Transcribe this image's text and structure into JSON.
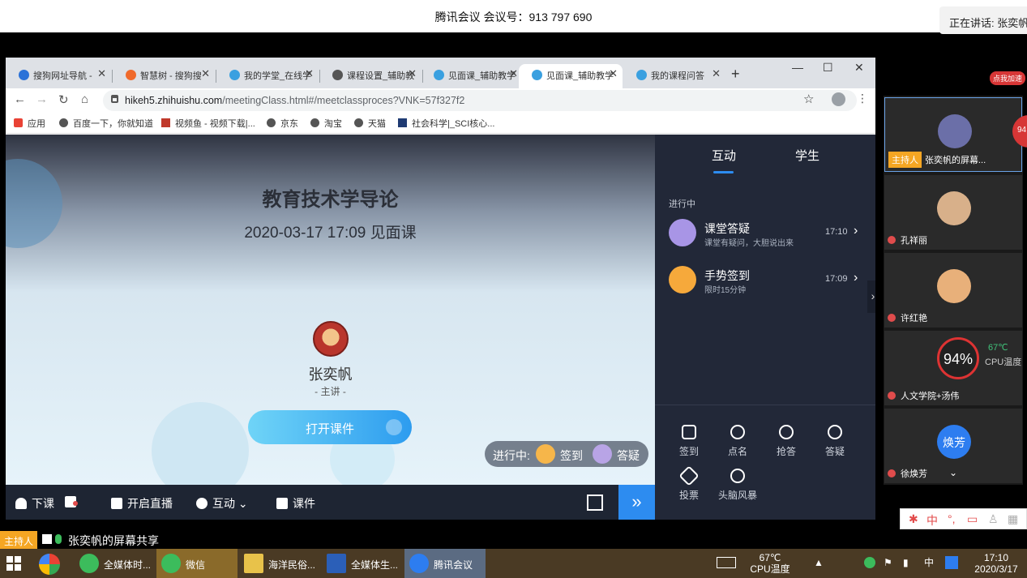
{
  "meeting": {
    "title": "腾讯会议 会议号：913 797 690",
    "speaking": "正在讲话: 张奕帆;"
  },
  "browser": {
    "tabs": [
      {
        "label": "搜狗网址导航 -",
        "color": "#2b72d8"
      },
      {
        "label": "智慧树 - 搜狗搜",
        "color": "#f06a2c"
      },
      {
        "label": "我的学堂_在线学",
        "color": "#3aa0e0"
      },
      {
        "label": "课程设置_辅助教",
        "color": "#555555"
      },
      {
        "label": "见面课_辅助教学",
        "color": "#3aa0e0"
      },
      {
        "label": "见面课_辅助教学",
        "color": "#3aa0e0"
      },
      {
        "label": "我的课程问答",
        "color": "#3aa0e0"
      }
    ],
    "new_tab": "+",
    "window_controls": {
      "minimize": "—",
      "maximize": "☐",
      "close": "✕"
    },
    "url_domain": "hikeh5.zhihuishu.com",
    "url_path": "/meetingClass.html#/meetclassproces?VNK=57f327f2",
    "bookmarks": [
      "应用",
      "百度一下，你就知道",
      "视频鱼 - 视频下载|...",
      "京东",
      "淘宝",
      "天猫",
      "社会科学|_SCI核心..."
    ]
  },
  "stage": {
    "course_title": "教育技术学导论",
    "course_time": "2020-03-17 17:09 见面课",
    "host_name": "张奕帆",
    "host_role": "- 主讲 -",
    "open_button": "打开课件",
    "in_progress": {
      "label": "进行中:",
      "item1": "签到",
      "item2": "答疑"
    }
  },
  "controls": {
    "end_class": "下课",
    "live": "开启直播",
    "interact": "互动",
    "courseware": "课件",
    "more": "»"
  },
  "side": {
    "tabs": [
      "互动",
      "学生"
    ],
    "section": "进行中",
    "activities": [
      {
        "title": "课堂答疑",
        "sub": "课堂有疑问，大胆说出来",
        "time": "17:10",
        "color": "#a895e6"
      },
      {
        "title": "手势签到",
        "sub": "限时15分钟",
        "time": "17:09",
        "color": "#f6a93b"
      }
    ],
    "tools": [
      "签到",
      "点名",
      "抢答",
      "答疑",
      "投票",
      "头脑风暴"
    ]
  },
  "participants": [
    {
      "name": "张奕帆的屏幕...",
      "host": "主持人",
      "avatar_color": "#6b6fa8"
    },
    {
      "name": "孔祥丽",
      "avatar_color": "#d8b08a"
    },
    {
      "name": "许红艳",
      "avatar_color": "#e8b07a"
    },
    {
      "name": "人文学院+汤伟",
      "avatar_color": "#333333"
    },
    {
      "name": "徐焕芳",
      "avatar_color": "#2d7df0",
      "avatar_text": "焕芳"
    }
  ],
  "cpu_widget": {
    "percent": "94%",
    "temp": "67℃",
    "label": "CPU温度"
  },
  "speedup": "点我加速",
  "badge": "94",
  "share": {
    "host_tag": "主持人",
    "text": "张奕帆的屏幕共享"
  },
  "taskbar": {
    "items": [
      {
        "label": "全媒体时...",
        "color": "#3cbc5c"
      },
      {
        "label": "微信",
        "color": "#3cbc5c"
      },
      {
        "label": "海洋民俗...",
        "color": "#e8c24a"
      },
      {
        "label": "全媒体生...",
        "color": "#2b5fb8"
      },
      {
        "label": "腾讯会议",
        "color": "#2d7df0"
      }
    ],
    "cpu_temp": "67℃",
    "cpu_label": "CPU温度",
    "ime": "中",
    "time": "17:10",
    "date": "2020/3/17"
  }
}
